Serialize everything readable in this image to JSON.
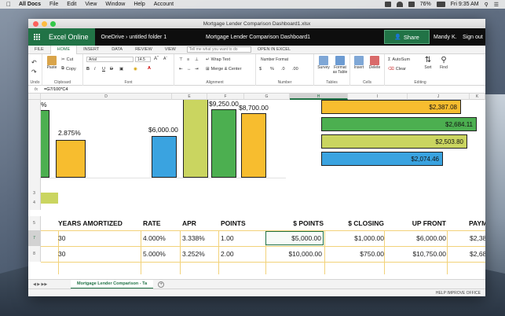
{
  "menubar": {
    "app": "All Docs",
    "items": [
      "File",
      "Edit",
      "View",
      "Window",
      "Help",
      "Account"
    ],
    "battery": "76%",
    "clock": "Fri 9:35 AM"
  },
  "window": {
    "title": "Mortgage Lender Comparison Dashboard1.xlsx"
  },
  "appbar": {
    "brand": "Excel Online",
    "breadcrumb": "OneDrive › untitled folder 1",
    "document": "Mortgage Lender Comparison Dashboard1",
    "share": "Share",
    "user": "Mandy K.",
    "signout": "Sign out"
  },
  "tabs": {
    "items": [
      "FILE",
      "HOME",
      "INSERT",
      "DATA",
      "REVIEW",
      "VIEW"
    ],
    "active": "HOME",
    "tellme_placeholder": "Tell me what you want to do",
    "open_in_excel": "OPEN IN EXCEL"
  },
  "ribbon": {
    "undo": "Undo",
    "paste": "Paste",
    "cut": "Cut",
    "copy": "Copy",
    "clipboard": "Clipboard",
    "font_name": "Arial",
    "font_size": "14.5",
    "font": "Font",
    "wrap_text": "Wrap Text",
    "merge_center": "Merge & Center",
    "alignment": "Alignment",
    "number_format": "Number Format",
    "number": "Number",
    "survey": "Survey",
    "format_as_table": "Format as Table",
    "tables": "Tables",
    "insert": "Insert",
    "delete": "Delete",
    "cells": "Cells",
    "autosum": "AutoSum",
    "clear": "Clear",
    "sort": "Sort",
    "find": "Find",
    "editing": "Editing"
  },
  "formula": {
    "fx": "fx",
    "value": "=G7/100*C4"
  },
  "columns": [
    "D",
    "E",
    "F",
    "G",
    "H",
    "I",
    "J",
    "K"
  ],
  "selected_column": "H",
  "rows": [
    "3",
    "4",
    "5",
    "7",
    "8"
  ],
  "chart_labels": {
    "pct_cut": "%",
    "pct": "2.875%",
    "e_bar": "$6,000.00",
    "g_bar": "$9,250.00",
    "h_bar": "$8,700.00",
    "h1": "$2,387.08",
    "h2": "$2,684.11",
    "h3": "$2,503.80",
    "h4": "$2,074.46"
  },
  "table": {
    "headers": [
      "YEARS AMORTIZED",
      "RATE",
      "APR",
      "POINTS",
      "$ POINTS",
      "$ CLOSING",
      "UP FRONT",
      "PAYM"
    ],
    "rows": [
      [
        "30",
        "4.000%",
        "3.338%",
        "1.00",
        "$5,000.00",
        "$1,000.00",
        "$6,000.00",
        "$2,38"
      ],
      [
        "30",
        "5.000%",
        "3.252%",
        "2.00",
        "$10,000.00",
        "$750.00",
        "$10,750.00",
        "$2,68"
      ]
    ]
  },
  "sheet": {
    "tab": "Mortgage Lender Comparison - Ta",
    "add": "+"
  },
  "status": {
    "help": "HELP IMPROVE OFFICE"
  },
  "colors": {
    "excel_green": "#217346",
    "bar_green": "#4caf50",
    "bar_yellow": "#f7bd2f",
    "bar_olive": "#cad560",
    "bar_blue": "#3aa3e0",
    "bar_orange": "#f7bd2f"
  }
}
